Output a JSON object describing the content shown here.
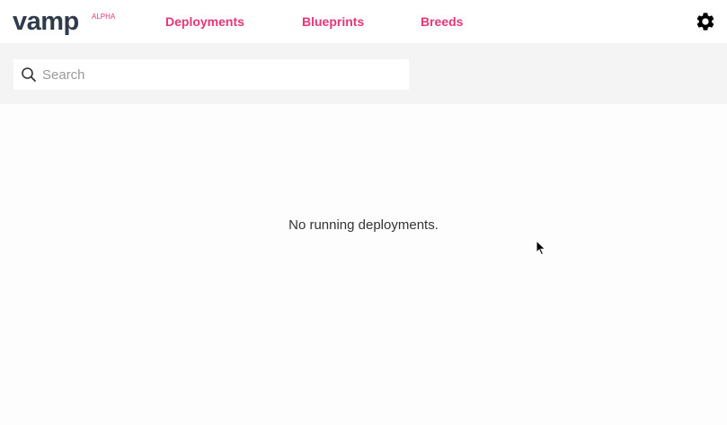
{
  "brand": {
    "name": "vamp",
    "badge": "ALPHA",
    "color": "#2f3a4a",
    "accent": "#e8357a"
  },
  "nav": {
    "items": [
      {
        "label": "Deployments"
      },
      {
        "label": "Blueprints"
      },
      {
        "label": "Breeds"
      }
    ],
    "settings_icon": "gear-icon"
  },
  "search": {
    "placeholder": "Search",
    "value": "",
    "icon": "search-icon"
  },
  "main": {
    "empty_message": "No running deployments."
  }
}
